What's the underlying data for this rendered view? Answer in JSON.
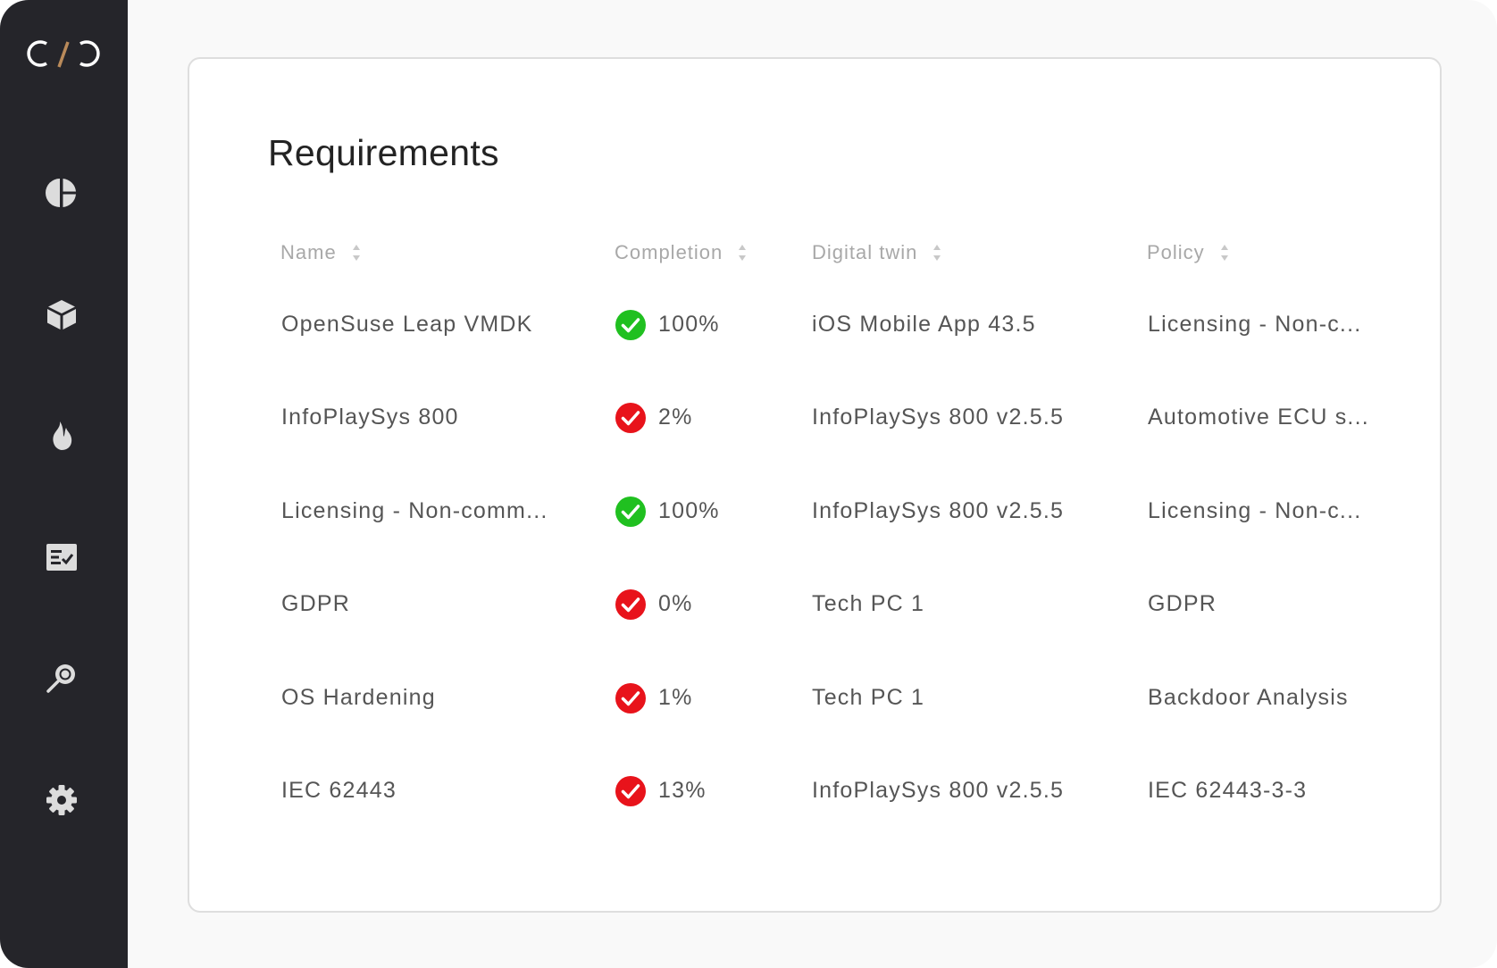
{
  "sidebar": {
    "logo_icon": "brand-logo-icon",
    "items": [
      {
        "icon": "pie-chart-icon"
      },
      {
        "icon": "cube-icon"
      },
      {
        "icon": "flame-icon"
      },
      {
        "icon": "checklist-icon"
      },
      {
        "icon": "magnifier-icon"
      },
      {
        "icon": "gear-icon"
      }
    ]
  },
  "page": {
    "title": "Requirements"
  },
  "table": {
    "columns": [
      {
        "label": "Name"
      },
      {
        "label": "Completion"
      },
      {
        "label": "Digital twin"
      },
      {
        "label": "Policy"
      }
    ],
    "rows": [
      {
        "name": "OpenSuse Leap VMDK",
        "status": "complete",
        "completion": "100%",
        "digital_twin": "iOS Mobile App 43.5",
        "policy": "Licensing - Non-c..."
      },
      {
        "name": "InfoPlaySys 800",
        "status": "incomplete",
        "completion": "2%",
        "digital_twin": "InfoPlaySys 800 v2.5.5",
        "policy": "Automotive ECU s..."
      },
      {
        "name": "Licensing - Non-comm...",
        "status": "complete",
        "completion": "100%",
        "digital_twin": "InfoPlaySys 800 v2.5.5",
        "policy": "Licensing - Non-c..."
      },
      {
        "name": "GDPR",
        "status": "incomplete",
        "completion": "0%",
        "digital_twin": "Tech PC 1",
        "policy": "GDPR"
      },
      {
        "name": "OS Hardening",
        "status": "incomplete",
        "completion": "1%",
        "digital_twin": "Tech PC 1",
        "policy": "Backdoor Analysis"
      },
      {
        "name": "IEC 62443",
        "status": "incomplete",
        "completion": "13%",
        "digital_twin": "InfoPlaySys 800 v2.5.5",
        "policy": "IEC 62443-3-3"
      }
    ]
  },
  "colors": {
    "sidebar_bg": "#25252a",
    "icon_color": "#dcdcdc",
    "logo_accent": "#b98a5a",
    "success": "#20c020",
    "danger": "#e8131b"
  }
}
